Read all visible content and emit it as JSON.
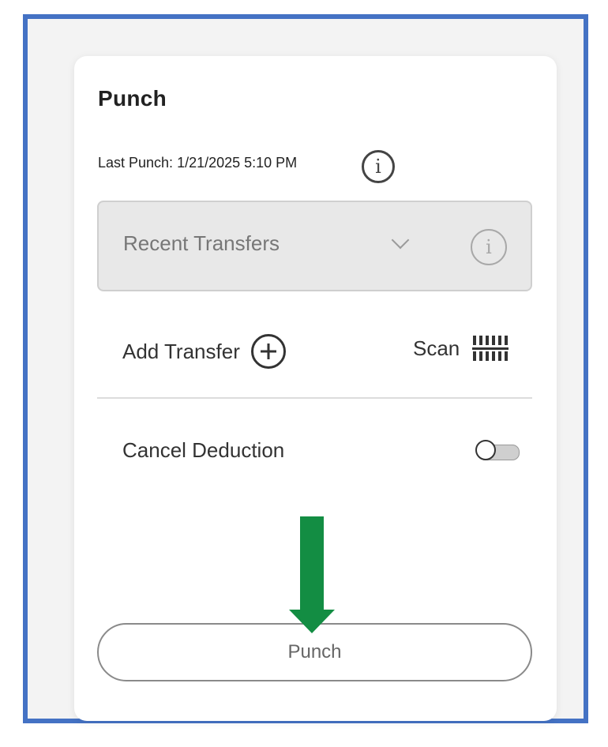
{
  "panel": {
    "title": "Punch",
    "last_punch_text": "Last Punch: 1/21/2025 5:10 PM"
  },
  "transfers_select": {
    "value": "Recent Transfers"
  },
  "actions": {
    "add_transfer_label": "Add Transfer",
    "scan_label": "Scan"
  },
  "cancel_deduction": {
    "label": "Cancel Deduction",
    "enabled": false
  },
  "punch_button": {
    "label": "Punch"
  },
  "colors": {
    "frame_border": "#4472c4",
    "annotation_arrow": "#138d43"
  },
  "icons": [
    "info-icon",
    "chevron-down-icon",
    "plus-circle-icon",
    "barcode-icon",
    "toggle-switch"
  ]
}
